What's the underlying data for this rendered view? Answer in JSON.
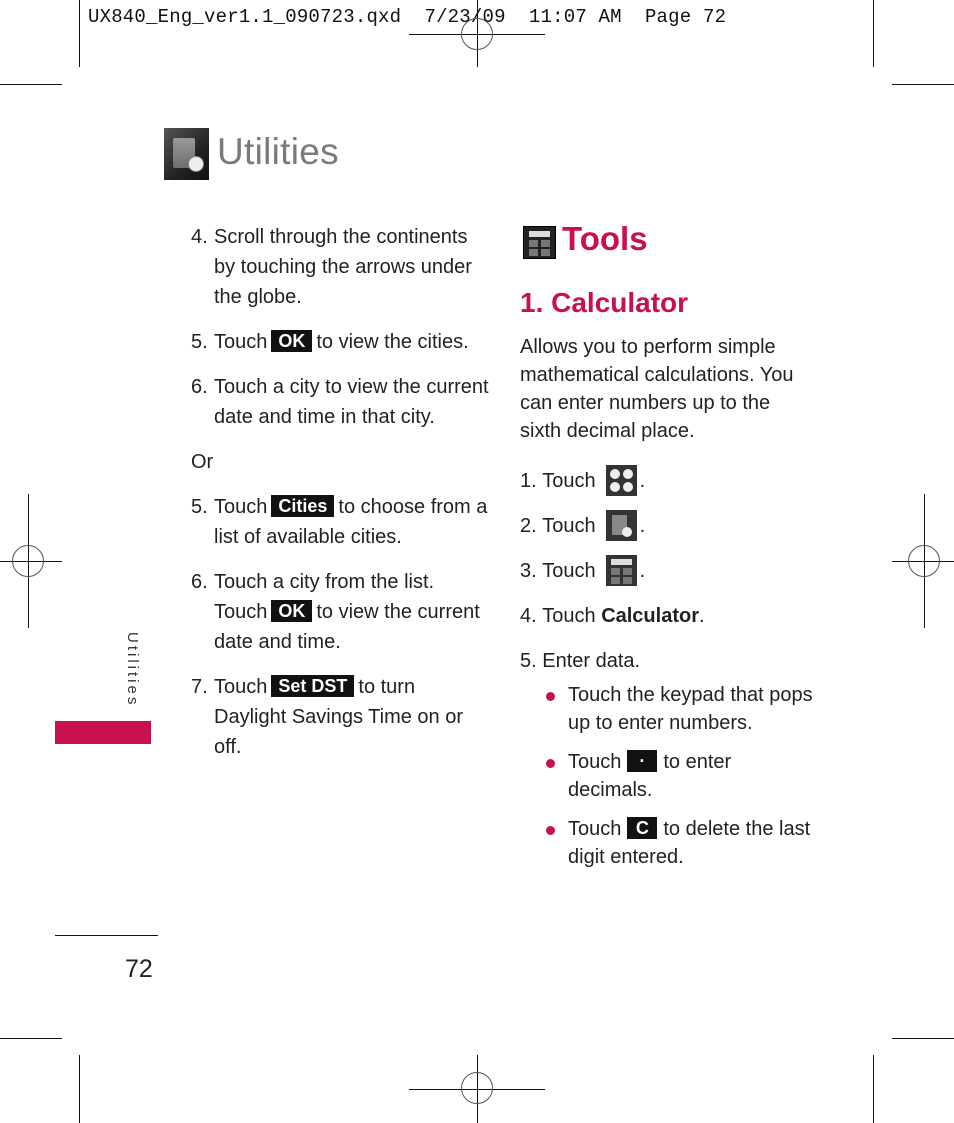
{
  "slug": {
    "filename": "UX840_Eng_ver1.1_090723.qxd",
    "date": "7/23/09",
    "time": "11:07 AM",
    "page_label": "Page 72"
  },
  "chapter": {
    "icon": "utilities-book-clock-icon",
    "title": "Utilities"
  },
  "left_column": {
    "steps": [
      {
        "num": "4.",
        "text": "Scroll through the continents by touching the arrows under the globe."
      },
      {
        "num": "5.",
        "pre": "Touch",
        "key": "OK",
        "post": "to view the cities."
      },
      {
        "num": "6.",
        "text": "Touch a city to view the current date and time in that city."
      },
      {
        "plain": "Or"
      },
      {
        "num": "5.",
        "pre": "Touch",
        "key": "Cities",
        "post": "to choose from a list of available cities."
      },
      {
        "num": "6.",
        "text1": "Touch a city from the list.",
        "pre": "Touch",
        "key": "OK",
        "post": "to view the current date and time."
      },
      {
        "num": "7.",
        "pre": "Touch",
        "key": "Set DST",
        "post": "to turn Daylight Savings Time on or off."
      }
    ]
  },
  "right_column": {
    "section_icon": "calculator-icon",
    "section_title": "Tools",
    "subsection_title": "1. Calculator",
    "intro": "Allows you to perform simple mathematical calculations. You can enter numbers up to the sixth decimal place.",
    "steps": [
      {
        "num": "1.",
        "pre": "Touch",
        "icon": "menu-grid-icon",
        "post": "."
      },
      {
        "num": "2.",
        "pre": "Touch",
        "icon": "utilities-icon",
        "post": "."
      },
      {
        "num": "3.",
        "pre": "Touch",
        "icon": "calculator-icon",
        "post": "."
      },
      {
        "num": "4.",
        "pre": "Touch",
        "bold": "Calculator",
        "post": "."
      },
      {
        "num": "5.",
        "text": "Enter data."
      }
    ],
    "bullets": [
      {
        "text": "Touch the keypad that pops up to enter numbers."
      },
      {
        "pre": "Touch",
        "key": "·",
        "post": "to enter decimals."
      },
      {
        "pre": "Touch",
        "key": "C",
        "post": "to delete the last digit entered."
      }
    ]
  },
  "side_tab": {
    "label": "Utilities",
    "color": "#c8104e"
  },
  "page_number": "72",
  "accent_color": "#c8104e"
}
